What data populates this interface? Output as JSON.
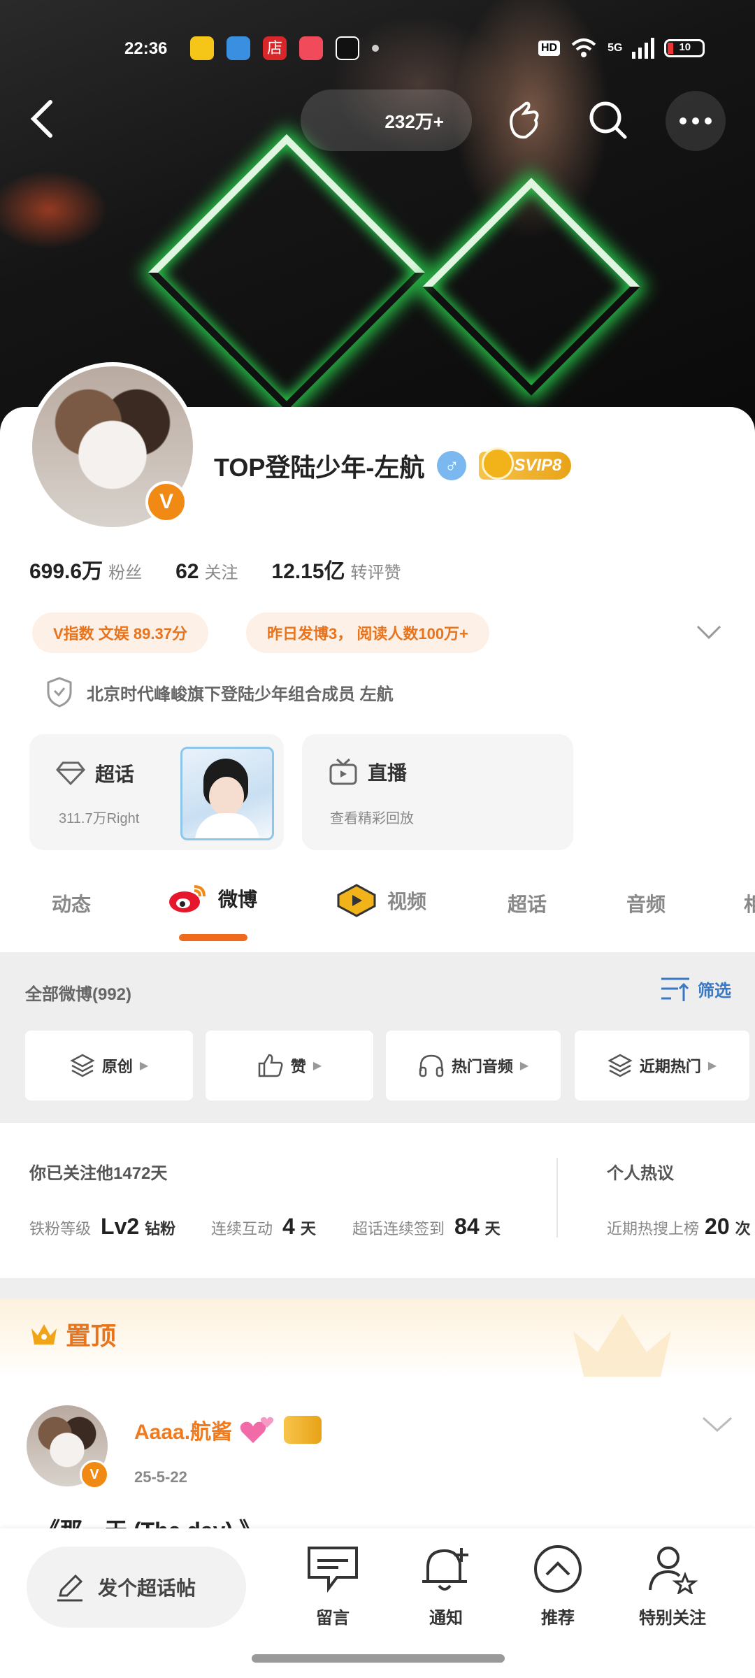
{
  "status": {
    "time": "22:36",
    "battery": "10",
    "network": "5G",
    "hd": "HD"
  },
  "header": {
    "followers_pill": "232万+"
  },
  "profile": {
    "name": "TOP登陆少年-左航",
    "gender_symbol": "♂",
    "vip_badge": "SVIP8",
    "verified_badge": "V",
    "stats": [
      {
        "value": "699.6万",
        "label": "粉丝"
      },
      {
        "value": "62",
        "label": "关注"
      },
      {
        "value": "12.15亿",
        "label": "转评赞"
      }
    ],
    "chips": [
      "V指数  文娱  89.37分",
      "昨日发博3， 阅读人数100万+"
    ],
    "description": "北京时代峰峻旗下登陆少年组合成员  左航"
  },
  "cards": {
    "supertopic": {
      "title": "超话",
      "sub": "311.7万Right"
    },
    "live": {
      "title": "直播",
      "sub": "查看精彩回放"
    }
  },
  "tabs": [
    "动态",
    "微博",
    "视频",
    "超话",
    "音频",
    "相"
  ],
  "posts_header": {
    "count_label": "全部微博(992)",
    "filter_label": "筛选"
  },
  "filters": [
    "原创",
    "赞",
    "热门音频",
    "近期热门"
  ],
  "fan_info": {
    "follow_days": "你已关注他1472天",
    "level_label": "铁粉等级",
    "level_value": "Lv2",
    "level_suffix": "钻粉",
    "interact_label": "连续互动",
    "interact_value": "4",
    "interact_unit": "天",
    "checkin_label": "超话连续签到",
    "checkin_value": "84",
    "checkin_unit": "天",
    "hot_title": "个人热议",
    "hot_label": "近期热搜上榜",
    "hot_value": "20",
    "hot_unit": "次"
  },
  "pinned": {
    "label": "置顶"
  },
  "post": {
    "author": "Aaaa.航酱",
    "date": "25-5-22",
    "text": "《那一天  (The day) 》"
  },
  "bottom_bar": {
    "compose": "发个超话帖",
    "items": [
      "留言",
      "通知",
      "推荐",
      "特别关注"
    ]
  },
  "colors": {
    "accent": "#f08a14",
    "link": "#3a78c3"
  }
}
